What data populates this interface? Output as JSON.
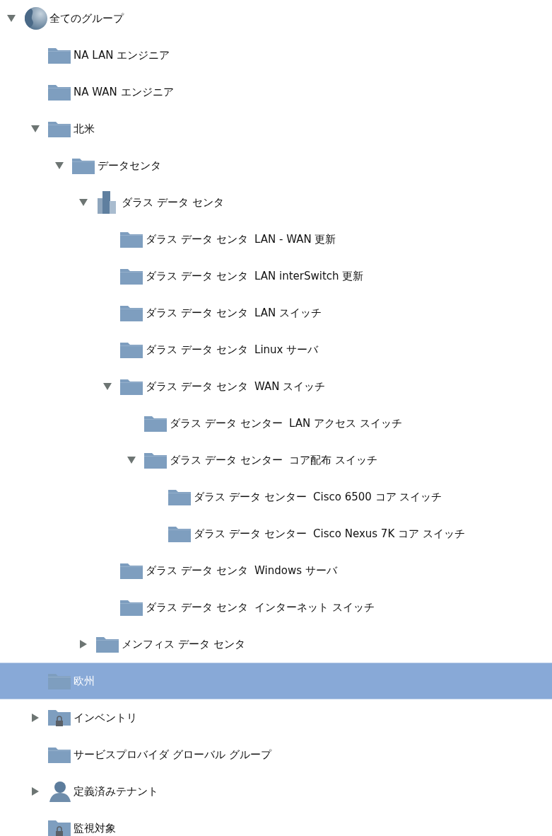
{
  "tree": [
    {
      "label": "全てのグループ",
      "kind": "globe",
      "expandable": true,
      "expanded": true,
      "selected": false,
      "children": [
        {
          "label": "NA LAN エンジニア",
          "kind": "folder",
          "expandable": false,
          "selected": false
        },
        {
          "label": "NA WAN エンジニア",
          "kind": "folder",
          "expandable": false,
          "selected": false
        },
        {
          "label": "北米",
          "kind": "folder",
          "expandable": true,
          "expanded": true,
          "selected": false,
          "children": [
            {
              "label": "データセンタ",
              "kind": "folder",
              "expandable": true,
              "expanded": true,
              "selected": false,
              "children": [
                {
                  "label": "ダラス データ センタ",
                  "kind": "building",
                  "expandable": true,
                  "expanded": true,
                  "selected": false,
                  "children": [
                    {
                      "label": "ダラス データ センタ  LAN - WAN 更新",
                      "kind": "folder",
                      "expandable": false,
                      "selected": false
                    },
                    {
                      "label": "ダラス データ センタ  LAN interSwitch 更新",
                      "kind": "folder",
                      "expandable": false,
                      "selected": false
                    },
                    {
                      "label": "ダラス データ センタ  LAN スイッチ",
                      "kind": "folder",
                      "expandable": false,
                      "selected": false
                    },
                    {
                      "label": "ダラス データ センタ  Linux サーバ",
                      "kind": "folder",
                      "expandable": false,
                      "selected": false
                    },
                    {
                      "label": "ダラス データ センタ  WAN スイッチ",
                      "kind": "folder",
                      "expandable": true,
                      "expanded": true,
                      "selected": false,
                      "children": [
                        {
                          "label": "ダラス データ センター  LAN アクセス スイッチ",
                          "kind": "folder",
                          "expandable": false,
                          "selected": false
                        },
                        {
                          "label": "ダラス データ センター  コア配布 スイッチ",
                          "kind": "folder",
                          "expandable": true,
                          "expanded": true,
                          "selected": false,
                          "children": [
                            {
                              "label": "ダラス データ センター  Cisco 6500 コア スイッチ",
                              "kind": "folder",
                              "expandable": false,
                              "selected": false
                            },
                            {
                              "label": "ダラス データ センター  Cisco Nexus 7K コア スイッチ",
                              "kind": "folder",
                              "expandable": false,
                              "selected": false
                            }
                          ]
                        }
                      ]
                    },
                    {
                      "label": "ダラス データ センタ  Windows サーバ",
                      "kind": "folder",
                      "expandable": false,
                      "selected": false
                    },
                    {
                      "label": "ダラス データ センタ  インターネット スイッチ",
                      "kind": "folder",
                      "expandable": false,
                      "selected": false
                    }
                  ]
                },
                {
                  "label": "メンフィス データ センタ",
                  "kind": "folder",
                  "expandable": true,
                  "expanded": false,
                  "selected": false
                }
              ]
            }
          ]
        },
        {
          "label": "欧州",
          "kind": "folder",
          "expandable": false,
          "selected": true
        },
        {
          "label": "インベントリ",
          "kind": "locked-folder",
          "expandable": true,
          "expanded": false,
          "selected": false
        },
        {
          "label": "サービスプロバイダ グローバル グループ",
          "kind": "folder",
          "expandable": false,
          "selected": false
        },
        {
          "label": "定義済みテナント",
          "kind": "person",
          "expandable": true,
          "expanded": false,
          "selected": false
        },
        {
          "label": "監視対象",
          "kind": "locked-folder",
          "expandable": false,
          "selected": false
        }
      ]
    }
  ]
}
